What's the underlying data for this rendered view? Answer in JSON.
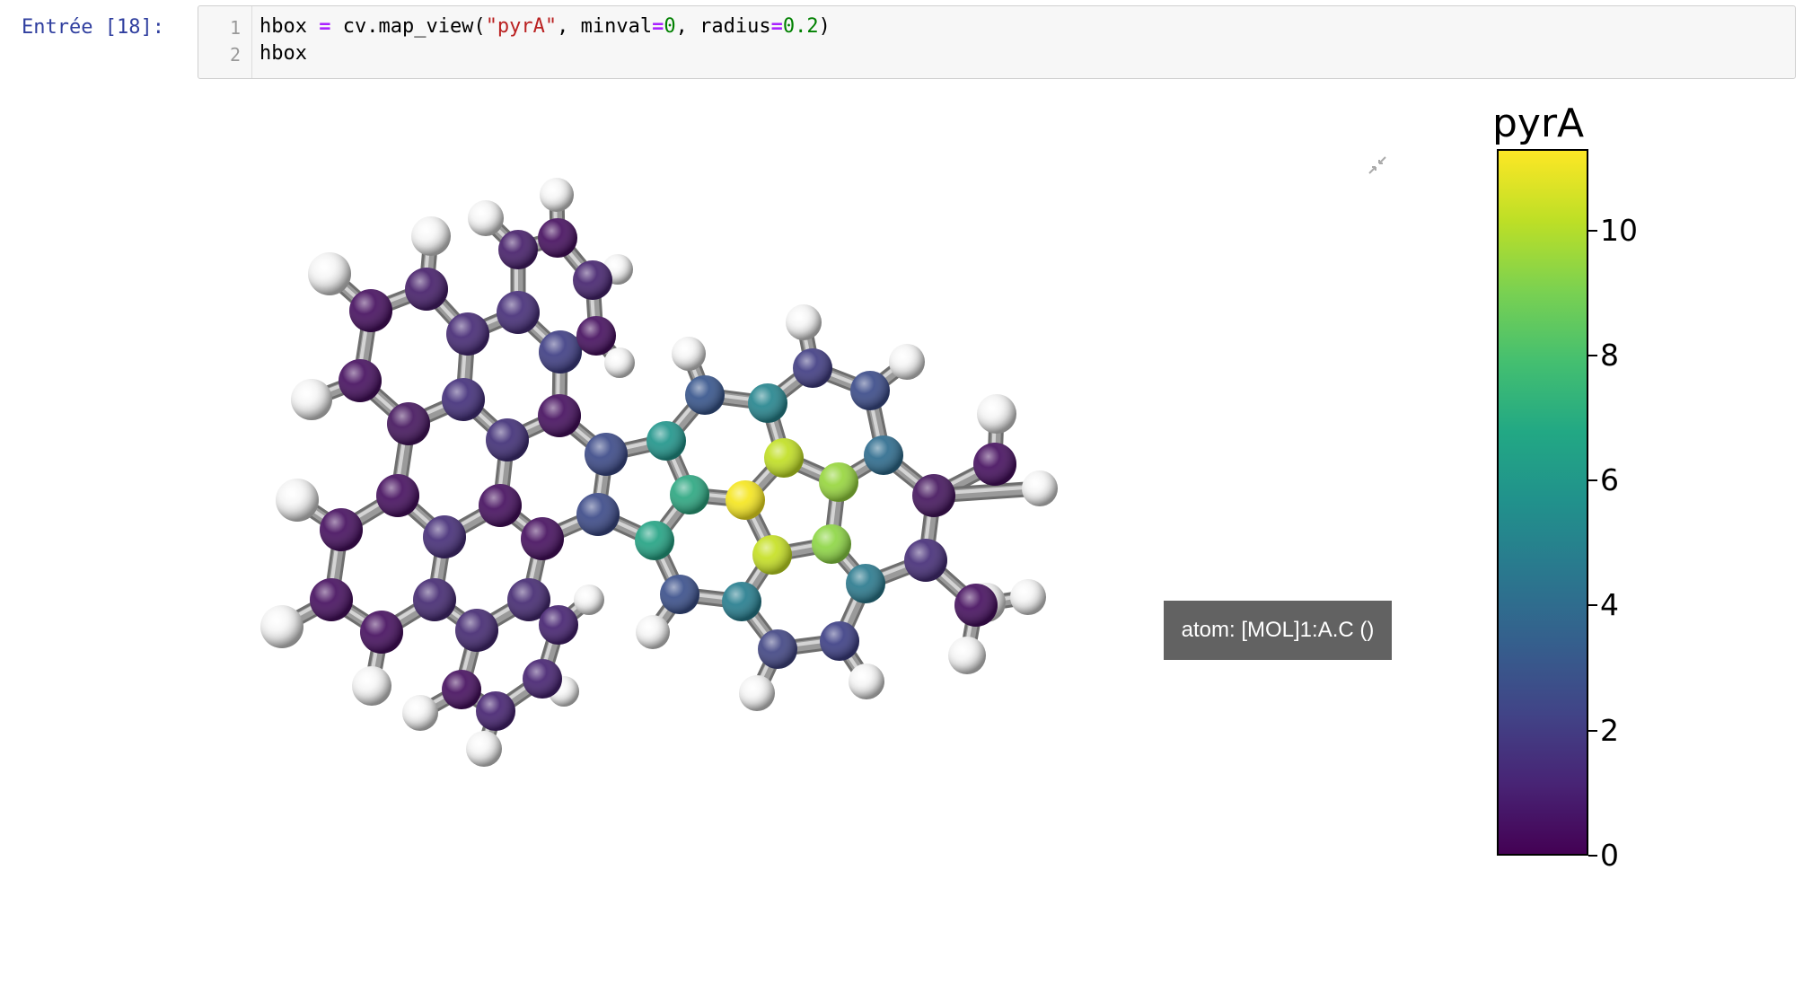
{
  "cell": {
    "prompt": "Entrée [18]:",
    "line_numbers": [
      "1",
      "2"
    ],
    "code": {
      "var": "hbox",
      "assign": "=",
      "call": "cv.map_view(",
      "arg1": "\"pyrA\"",
      "sep1": ", minval",
      "eq1": "=",
      "val1": "0",
      "sep2": ", radius",
      "eq2": "=",
      "val2": "0.2",
      "close": ")",
      "line2": "hbox"
    }
  },
  "viewer": {
    "tooltip": "atom: [MOL]1:A.C ()",
    "minimize_icon": "minimize-icon"
  },
  "colorbar": {
    "title": "pyrA",
    "ticks": [
      "0",
      "2",
      "4",
      "6",
      "8",
      "10"
    ],
    "tick_values": [
      0,
      2,
      4,
      6,
      8,
      10
    ],
    "range": [
      0,
      11.3
    ],
    "colormap": "viridis"
  },
  "colors": {
    "prompt": "#303f9f",
    "hydrogen": "#f2f2f2",
    "bond": "#8f8f8f"
  }
}
